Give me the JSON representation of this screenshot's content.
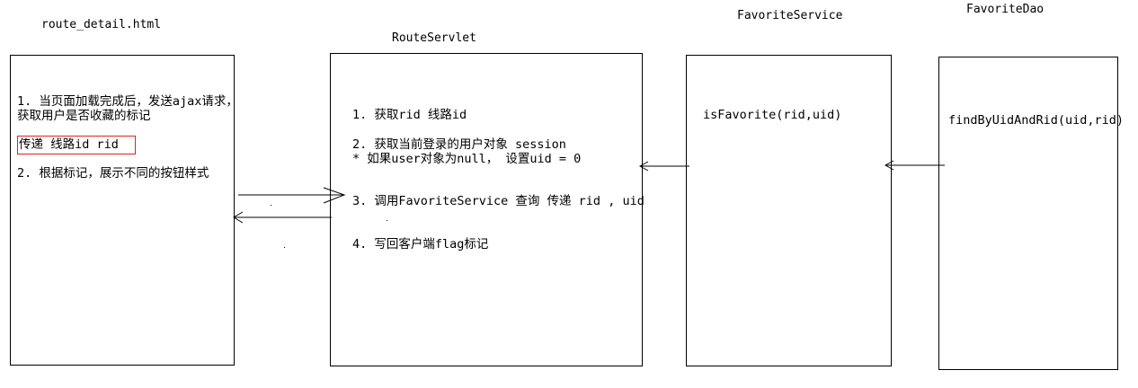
{
  "columns": [
    {
      "title": "route_detail.html",
      "lines": [
        "1. 当页面加载完成后，发送ajax请求，",
        "获取用户是否收藏的标记",
        "2. 根据标记，展示不同的按钮样式"
      ],
      "highlight": "传递 线路id  rid"
    },
    {
      "title": "RouteServlet",
      "lines": [
        "1. 获取rid 线路id",
        "2. 获取当前登录的用户对象 session",
        "  * 如果user对象为null， 设置uid = 0",
        "3. 调用FavoriteService 查询  传递 rid , uid",
        "4. 写回客户端flag标记"
      ]
    },
    {
      "title": "FavoriteService",
      "lines": [
        "isFavorite(rid,uid)"
      ]
    },
    {
      "title": "FavoriteDao",
      "lines": [
        "findByUidAndRid(uid,rid)"
      ]
    }
  ]
}
